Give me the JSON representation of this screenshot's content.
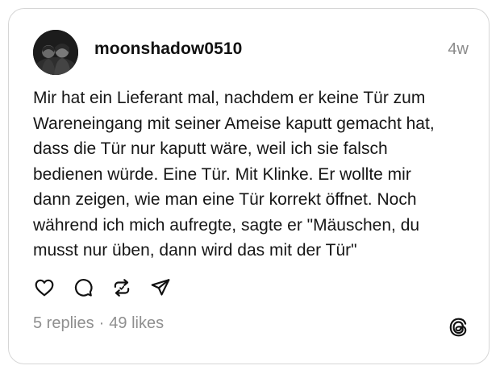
{
  "post": {
    "username": "moonshadow0510",
    "time": "4w",
    "text": "Mir hat ein Lieferant mal, nachdem er keine Tür zum\nWareneingang mit seiner Ameise kaputt gemacht hat,\ndass die Tür nur kaputt wäre, weil ich sie falsch\nbedienen würde. Eine Tür. Mit Klinke. Er wollte mir\ndann zeigen, wie man eine Tür korrekt öffnet. Noch\nwährend ich mich aufregte, sagte er \"Mäuschen, du\nmusst nur üben, dann wird das mit der Tür\"",
    "replies": "5 replies",
    "separator": "·",
    "likes": "49 likes"
  },
  "icons": {
    "like": "heart-icon",
    "reply": "comment-icon",
    "repost": "repost-icon",
    "share": "send-icon",
    "brand": "threads-logo-icon"
  },
  "colors": {
    "text": "#161616",
    "muted": "#8f8f8f",
    "border": "#d6d6d6"
  }
}
